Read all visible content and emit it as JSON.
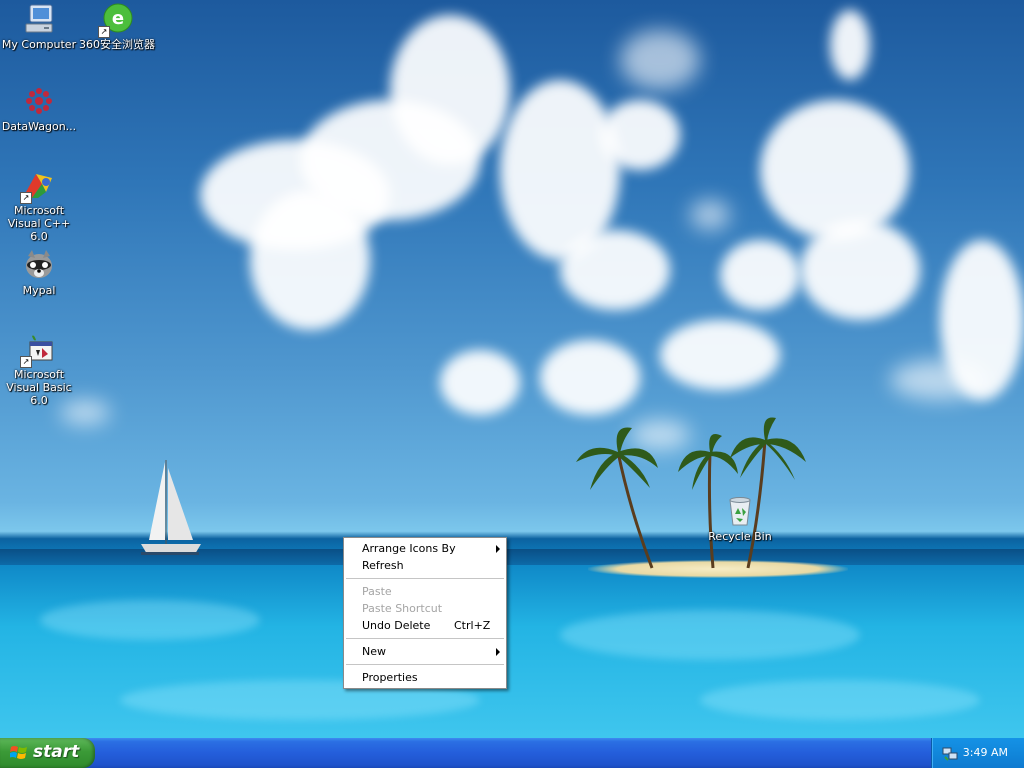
{
  "desktop": {
    "icons": [
      {
        "label": "My Computer",
        "icon": "my-computer-icon"
      },
      {
        "label": "360安全浏览器",
        "icon": "360-browser-icon"
      },
      {
        "label": "DataWagon...",
        "icon": "datawagon-icon"
      },
      {
        "label": "Microsoft Visual C++ 6.0",
        "icon": "visual-cpp-icon"
      },
      {
        "label": "Mypal",
        "icon": "mypal-icon"
      },
      {
        "label": "Microsoft Visual Basic 6.0",
        "icon": "visual-basic-icon"
      },
      {
        "label": "Recycle Bin",
        "icon": "recycle-bin-icon"
      }
    ]
  },
  "context_menu": {
    "items": [
      {
        "label": "Arrange Icons By",
        "submenu": true,
        "enabled": true
      },
      {
        "label": "Refresh",
        "enabled": true
      },
      {
        "label": "Paste",
        "enabled": false
      },
      {
        "label": "Paste Shortcut",
        "enabled": false
      },
      {
        "label": "Undo Delete",
        "shortcut": "Ctrl+Z",
        "enabled": true
      },
      {
        "label": "New",
        "submenu": true,
        "enabled": true
      },
      {
        "label": "Properties",
        "enabled": true
      }
    ]
  },
  "taskbar": {
    "start_label": "start",
    "clock": "3:49 AM",
    "tray_icon": "network-tray-icon"
  },
  "colors": {
    "taskbar_blue": "#245edb",
    "start_green": "#3b9a37",
    "tray_blue": "#1187db",
    "disabled_text": "#a5a5a5"
  }
}
